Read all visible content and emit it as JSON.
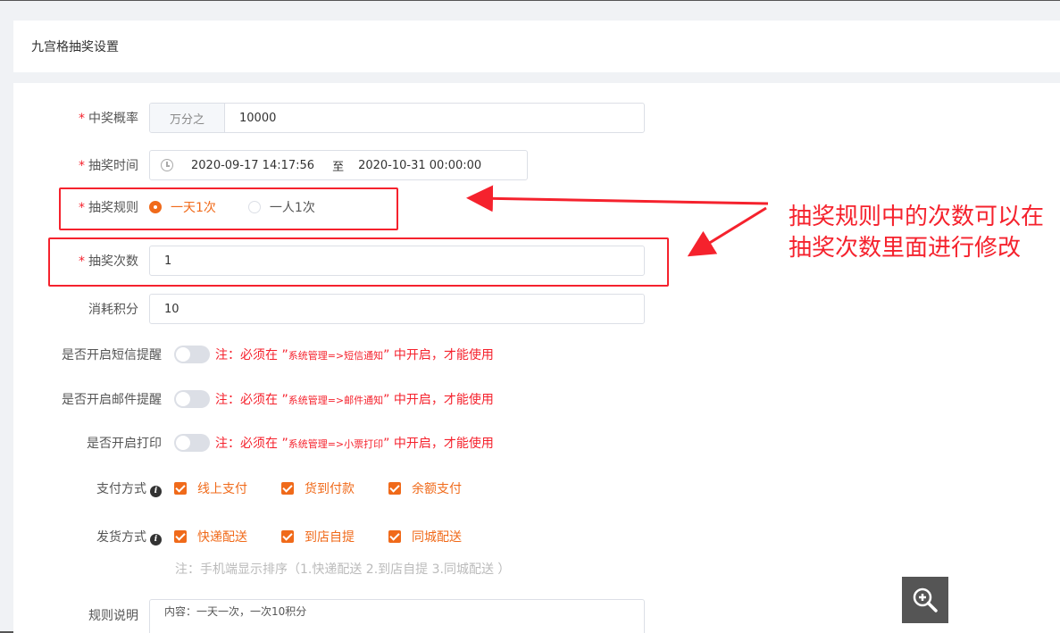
{
  "header": {
    "title": "九宫格抽奖设置"
  },
  "form": {
    "probability": {
      "label": "中奖概率",
      "addon": "万分之",
      "value": "10000"
    },
    "time": {
      "label": "抽奖时间",
      "start": "2020-09-17 14:17:56",
      "separator": "至",
      "end": "2020-10-31 00:00:00"
    },
    "rule": {
      "label": "抽奖规则",
      "options": [
        "一天1次",
        "一人1次"
      ],
      "selected": "一天1次"
    },
    "count": {
      "label": "抽奖次数",
      "value": "1"
    },
    "points": {
      "label": "消耗积分",
      "value": "10"
    },
    "sms": {
      "label": "是否开启短信提醒",
      "note_prefix": "注：必须在 ”",
      "note_path": "系统管理=>短信通知",
      "note_suffix": "” 中开启，才能使用"
    },
    "email": {
      "label": "是否开启邮件提醒",
      "note_prefix": "注：必须在 ”",
      "note_path": "系统管理=>邮件通知",
      "note_suffix": "” 中开启，才能使用"
    },
    "print": {
      "label": "是否开启打印",
      "note_prefix": "注：必须在 ”",
      "note_path": "系统管理=>小票打印",
      "note_suffix": "” 中开启，才能使用"
    },
    "payment": {
      "label": "支付方式",
      "options": [
        "线上支付",
        "货到付款",
        "余额支付"
      ]
    },
    "delivery": {
      "label": "发货方式",
      "options": [
        "快递配送",
        "到店自提",
        "同城配送"
      ],
      "hint": "注：手机端显示排序（1.快递配送 2.到店自提 3.同城配送 ）"
    },
    "description": {
      "label": "规则说明",
      "value": "内容：一天一次，一次10积分"
    }
  },
  "annotation": {
    "text": "抽奖规则中的次数可以在抽奖次数里面进行修改"
  },
  "colors": {
    "accent": "#f06a1a",
    "annotation": "#f5222d"
  },
  "icons": {
    "zoom": "zoom-in-icon",
    "clock": "clock-icon",
    "info": "info-icon"
  }
}
